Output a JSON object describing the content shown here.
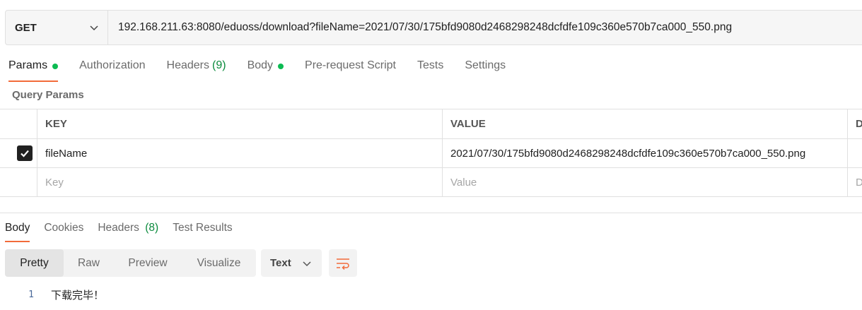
{
  "request": {
    "method": "GET",
    "url": "192.168.211.63:8080/eduoss/download?fileName=2021/07/30/175bfd9080d2468298248dcfdfe109c360e570b7ca000_550.png"
  },
  "request_tabs": [
    {
      "label": "Params",
      "dot": true,
      "active": true
    },
    {
      "label": "Authorization"
    },
    {
      "label": "Headers",
      "count": "(9)"
    },
    {
      "label": "Body",
      "dot": true
    },
    {
      "label": "Pre-request Script"
    },
    {
      "label": "Tests"
    },
    {
      "label": "Settings"
    }
  ],
  "query_params": {
    "title": "Query Params",
    "headers": {
      "key": "KEY",
      "value": "VALUE",
      "desc": "D"
    },
    "rows": [
      {
        "checked": true,
        "key": "fileName",
        "value": "2021/07/30/175bfd9080d2468298248dcfdfe109c360e570b7ca000_550.png"
      }
    ],
    "placeholder": {
      "key": "Key",
      "value": "Value",
      "desc": "D"
    }
  },
  "response_tabs": [
    {
      "label": "Body",
      "active": true
    },
    {
      "label": "Cookies"
    },
    {
      "label": "Headers",
      "count": "(8)"
    },
    {
      "label": "Test Results"
    }
  ],
  "view_modes": [
    "Pretty",
    "Raw",
    "Preview",
    "Visualize"
  ],
  "active_view": "Pretty",
  "format": "Text",
  "output": {
    "line": "1",
    "text": "下载完毕！"
  },
  "colors": {
    "accent": "#f26b3a",
    "dot": "#0cbb52",
    "count": "#0a8a3c"
  },
  "icons": {
    "method_dropdown": "chevron-down-icon",
    "format_dropdown": "chevron-down-icon",
    "wrap": "wrap-lines-icon",
    "checkbox": "checkmark-icon"
  }
}
